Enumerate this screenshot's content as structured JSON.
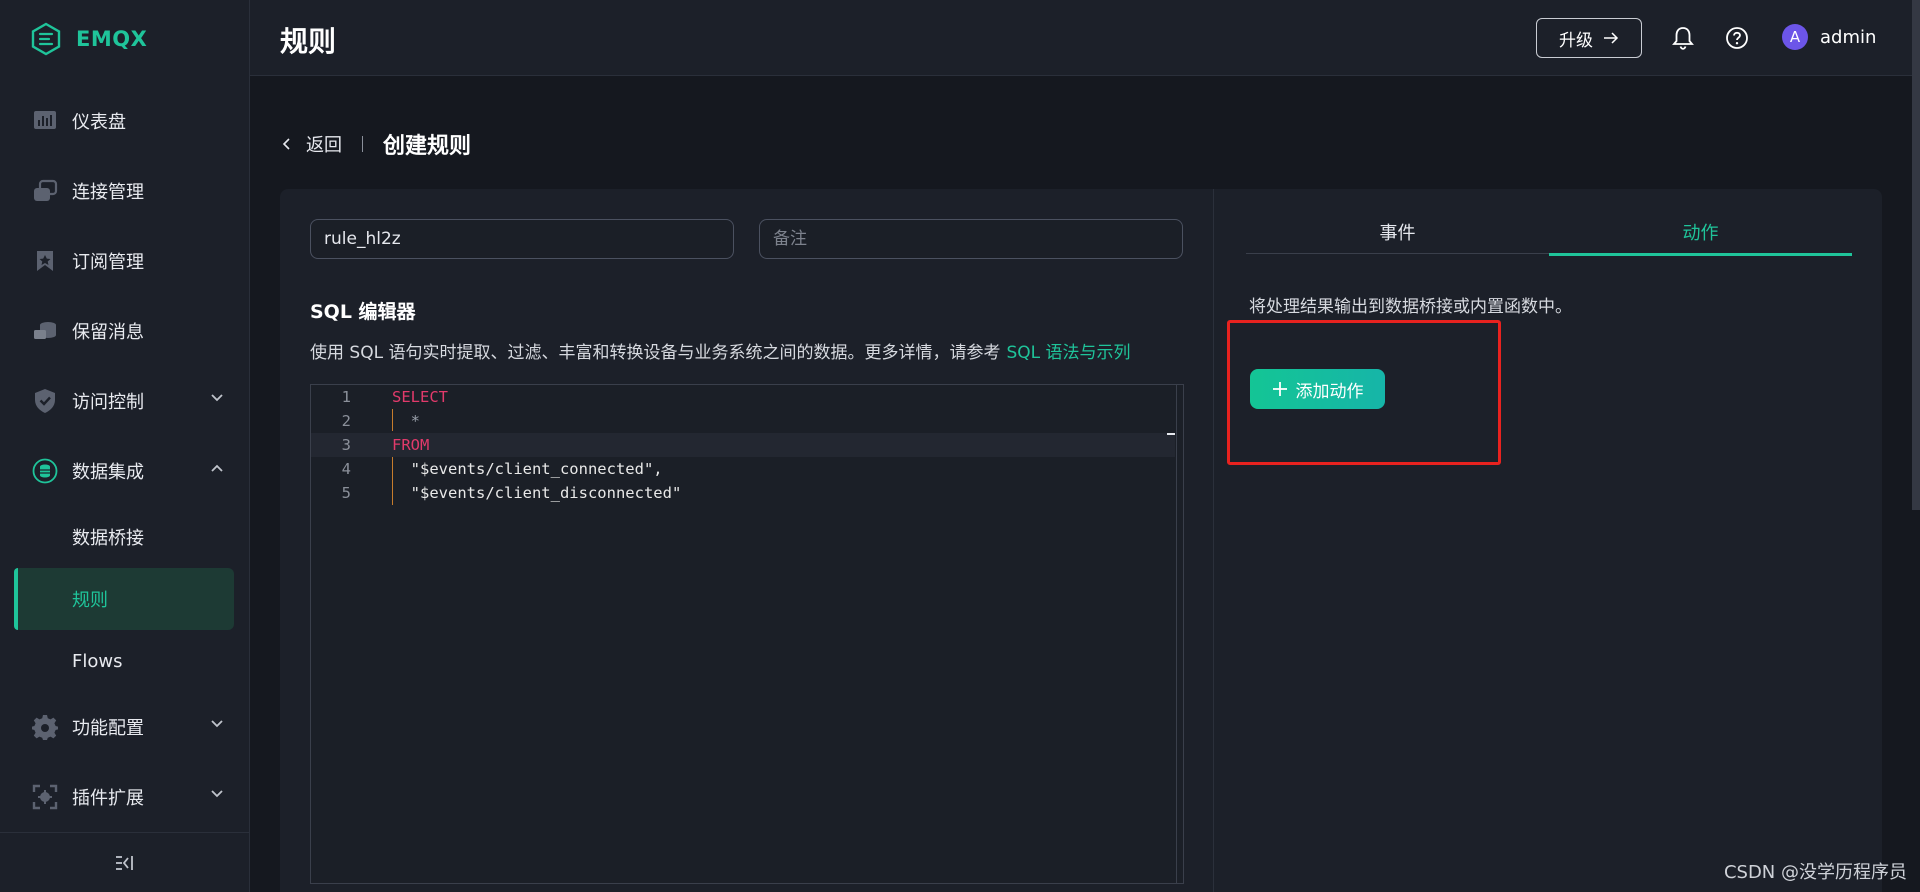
{
  "app": {
    "name": "EMQX"
  },
  "sidebar": {
    "items": [
      {
        "label": "仪表盘",
        "icon": "dashboard-icon"
      },
      {
        "label": "连接管理",
        "icon": "connections-icon"
      },
      {
        "label": "订阅管理",
        "icon": "subscriptions-icon"
      },
      {
        "label": "保留消息",
        "icon": "retained-messages-icon"
      },
      {
        "label": "访问控制",
        "icon": "shield-icon",
        "expandable": true
      },
      {
        "label": "数据集成",
        "icon": "database-icon",
        "expanded": true
      },
      {
        "label": "功能配置",
        "icon": "gear-icon",
        "expandable": true
      },
      {
        "label": "插件扩展",
        "icon": "plugin-icon",
        "expandable": true
      }
    ],
    "subitems": [
      {
        "label": "数据桥接"
      },
      {
        "label": "规则",
        "active": true
      },
      {
        "label": "Flows"
      }
    ]
  },
  "header": {
    "title": "规则",
    "upgrade_label": "升级",
    "user": {
      "avatar_letter": "A",
      "name": "admin"
    }
  },
  "breadcrumb": {
    "back_label": "返回",
    "title": "创建规则"
  },
  "form": {
    "rule_id_value": "rule_hl2z",
    "note_placeholder": "备注"
  },
  "sql_editor": {
    "heading": "SQL 编辑器",
    "description": "使用 SQL 语句实时提取、过滤、丰富和转换设备与业务系统之间的数据。更多详情，请参考",
    "doc_link": "SQL 语法与示列",
    "lines": [
      {
        "num": "1",
        "text": "SELECT"
      },
      {
        "num": "2",
        "text": "  *"
      },
      {
        "num": "3",
        "text": "FROM"
      },
      {
        "num": "4",
        "text": "  \"$events/client_connected\","
      },
      {
        "num": "5",
        "text": "  \"$events/client_disconnected\""
      }
    ]
  },
  "tabs": [
    {
      "label": "事件"
    },
    {
      "label": "动作",
      "active": true
    }
  ],
  "actions": {
    "description": "将处理结果输出到数据桥接或内置函数中。",
    "add_label": "添加动作"
  },
  "watermark": "CSDN @没学历程序员",
  "colors": {
    "accent": "#1fc49a",
    "keyword": "#e23a6b",
    "highlight": "#e8221f",
    "avatar": "#6c55e8"
  }
}
